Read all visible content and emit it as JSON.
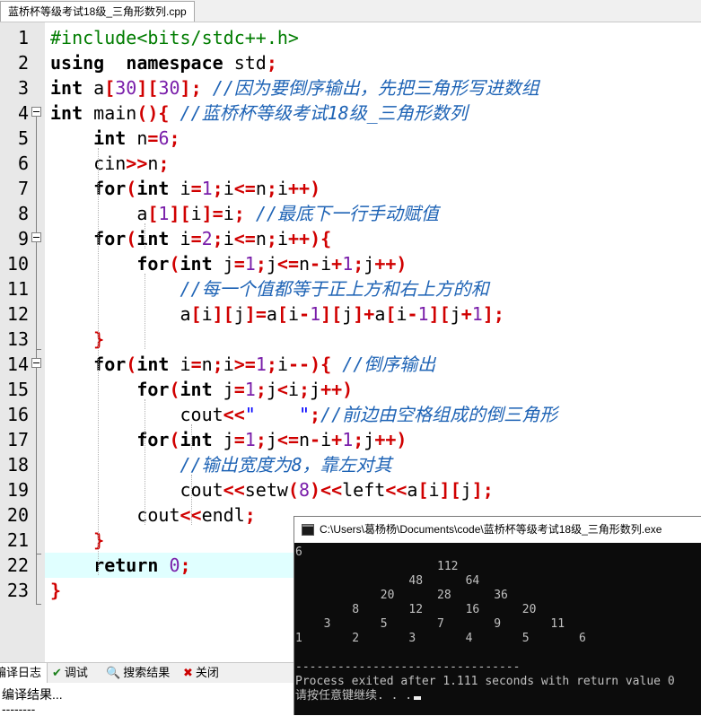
{
  "tab": {
    "title": "蓝桥杯等级考试18级_三角形数列.cpp"
  },
  "editor": {
    "line_numbers": [
      "1",
      "2",
      "3",
      "4",
      "5",
      "6",
      "7",
      "8",
      "9",
      "10",
      "11",
      "12",
      "13",
      "14",
      "15",
      "16",
      "17",
      "18",
      "19",
      "20",
      "21",
      "22",
      "23"
    ]
  },
  "bottom": {
    "tabs": [
      {
        "label": "编译日志",
        "icon": "log-icon"
      },
      {
        "label": "调试",
        "icon": "checkmark-icon"
      },
      {
        "label": "搜索结果",
        "icon": "search-icon"
      },
      {
        "label": "关闭",
        "icon": "close-icon"
      }
    ],
    "panel_lines": [
      "编译结果...",
      "--------"
    ]
  },
  "console": {
    "title": "C:\\Users\\葛杨杨\\Documents\\code\\蓝桥杯等级考试18级_三角形数列.exe",
    "input_echo": "6",
    "triangle_rows": [
      [
        "112"
      ],
      [
        "48",
        "64"
      ],
      [
        "20",
        "28",
        "36"
      ],
      [
        "8",
        "12",
        "16",
        "20"
      ],
      [
        "3",
        "5",
        "7",
        "9",
        "11"
      ],
      [
        "1",
        "2",
        "3",
        "4",
        "5",
        "6"
      ]
    ],
    "separator": "--------------------------------",
    "exit_message": "Process exited after 1.111 seconds with return value 0",
    "prompt": "请按任意键继续. . ."
  }
}
